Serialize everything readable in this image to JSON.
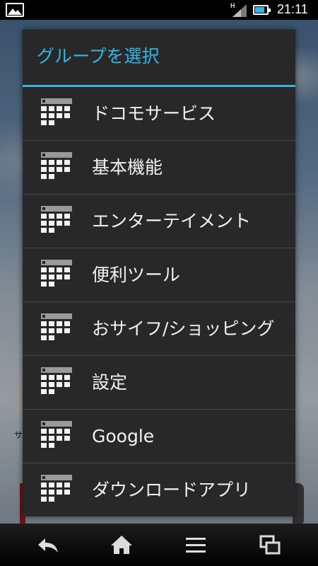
{
  "status_bar": {
    "network_type": "H",
    "time": "21:11",
    "battery_level": 0.8,
    "icons": [
      "gallery-notification-icon",
      "signal-icon",
      "battery-icon"
    ]
  },
  "background": {
    "partial_text": "サ"
  },
  "dialog": {
    "title": "グループを選択",
    "accent_color": "#33b5e5",
    "items": [
      {
        "label": "ドコモサービス",
        "icon": "group-grid-icon"
      },
      {
        "label": "基本機能",
        "icon": "group-grid-icon"
      },
      {
        "label": "エンターテイメント",
        "icon": "group-grid-icon"
      },
      {
        "label": "便利ツール",
        "icon": "group-grid-icon"
      },
      {
        "label": "おサイフ/ショッピング",
        "icon": "group-grid-icon"
      },
      {
        "label": "設定",
        "icon": "group-grid-icon"
      },
      {
        "label": "Google",
        "icon": "group-grid-icon"
      },
      {
        "label": "ダウンロードアプリ",
        "icon": "group-grid-icon"
      }
    ]
  },
  "nav_bar": {
    "buttons": [
      "back-icon",
      "home-icon",
      "menu-icon",
      "recent-apps-icon"
    ]
  }
}
